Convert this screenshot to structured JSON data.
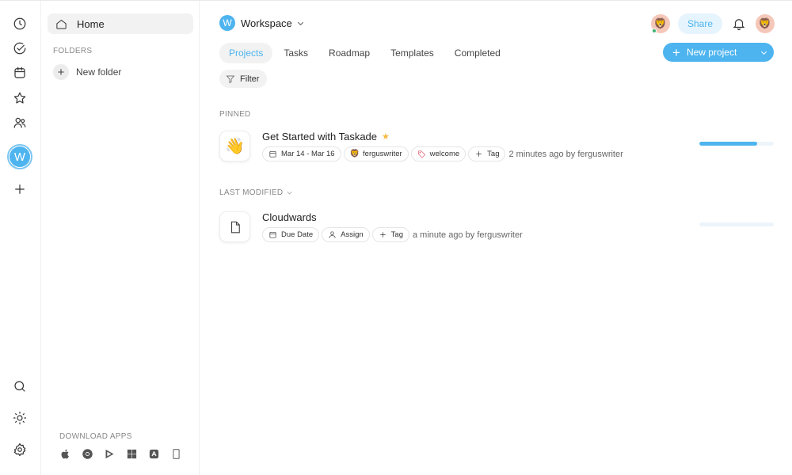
{
  "sidebar": {
    "home_label": "Home",
    "folders_label": "FOLDERS",
    "new_folder_label": "New folder",
    "download_label": "DOWNLOAD APPS"
  },
  "rail": {
    "workspace_initial": "W"
  },
  "header": {
    "workspace_initial": "W",
    "workspace_name": "Workspace",
    "share_label": "Share"
  },
  "tabs": [
    {
      "label": "Projects",
      "active": true
    },
    {
      "label": "Tasks"
    },
    {
      "label": "Roadmap"
    },
    {
      "label": "Templates"
    },
    {
      "label": "Completed"
    }
  ],
  "new_project_label": "New project",
  "filter_label": "Filter",
  "pinned": {
    "section_label": "PINNED",
    "project": {
      "icon": "👋",
      "title": "Get Started with Taskade",
      "date_chip": "Mar 14 - Mar 16",
      "user_chip": "ferguswriter",
      "tag_chip": "welcome",
      "add_tag": "Tag",
      "modified": "2 minutes ago by ferguswriter",
      "progress": 0.78
    }
  },
  "last_modified": {
    "section_label": "LAST MODIFIED",
    "project": {
      "icon": "document-icon",
      "title": "Cloudwards",
      "date_chip": "Due Date",
      "assign_chip": "Assign",
      "add_tag": "Tag",
      "modified": "a minute ago by ferguswriter",
      "progress": 0
    }
  },
  "colors": {
    "accent": "#4db4ef",
    "star": "#f6b93b"
  }
}
